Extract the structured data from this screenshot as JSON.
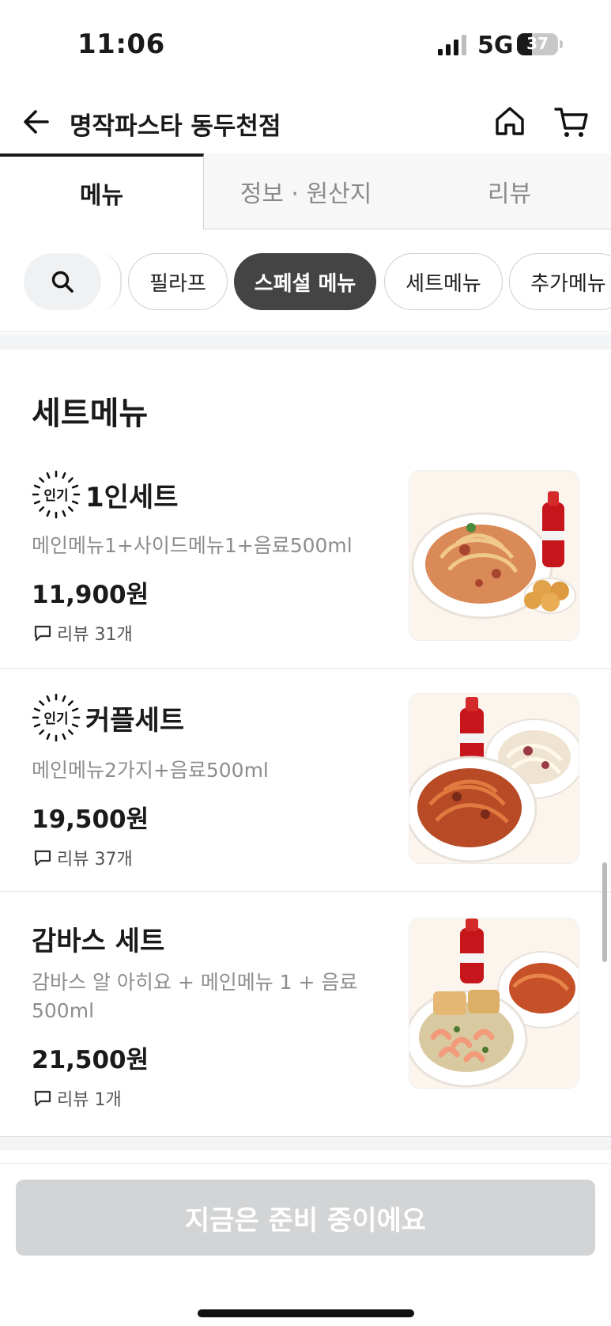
{
  "status_bar": {
    "time": "11:06",
    "network": "5G",
    "battery": "37",
    "battery_level": 0.37
  },
  "header": {
    "title": "명작파스타 동두천점",
    "back_icon": "back-arrow-icon",
    "home_icon": "home-icon",
    "cart_icon": "cart-icon"
  },
  "tabs": [
    {
      "label": "메뉴",
      "active": true
    },
    {
      "label": "정보 · 원산지",
      "active": false
    },
    {
      "label": "리뷰",
      "active": false
    }
  ],
  "categories": {
    "search_icon": "search-icon",
    "items": [
      {
        "label": "필라프",
        "selected": false
      },
      {
        "label": "스페셜 메뉴",
        "selected": true
      },
      {
        "label": "세트메뉴",
        "selected": false
      },
      {
        "label": "추가메뉴",
        "selected": false
      }
    ]
  },
  "section": {
    "title": "세트메뉴"
  },
  "menu_items": [
    {
      "badge": "인기",
      "name": "1인세트",
      "description": "메인메뉴1+사이드메뉴1+음료500ml",
      "price": "11,900원",
      "reviews": "리뷰 31개"
    },
    {
      "badge": "인기",
      "name": "커플세트",
      "description": "메인메뉴2가지+음료500ml",
      "price": "19,500원",
      "reviews": "리뷰 37개"
    },
    {
      "badge": "",
      "name": "감바스 세트",
      "description": "감바스 알 아히요 + 메인메뉴 1 + 음료 500ml",
      "price": "21,500원",
      "reviews": "리뷰 1개"
    }
  ],
  "cta": {
    "label": "지금은 준비 중이에요"
  },
  "colors": {
    "chip_selected": "#444444",
    "cta_disabled": "#d3d4d6",
    "muted_text": "#8d8d8d"
  }
}
